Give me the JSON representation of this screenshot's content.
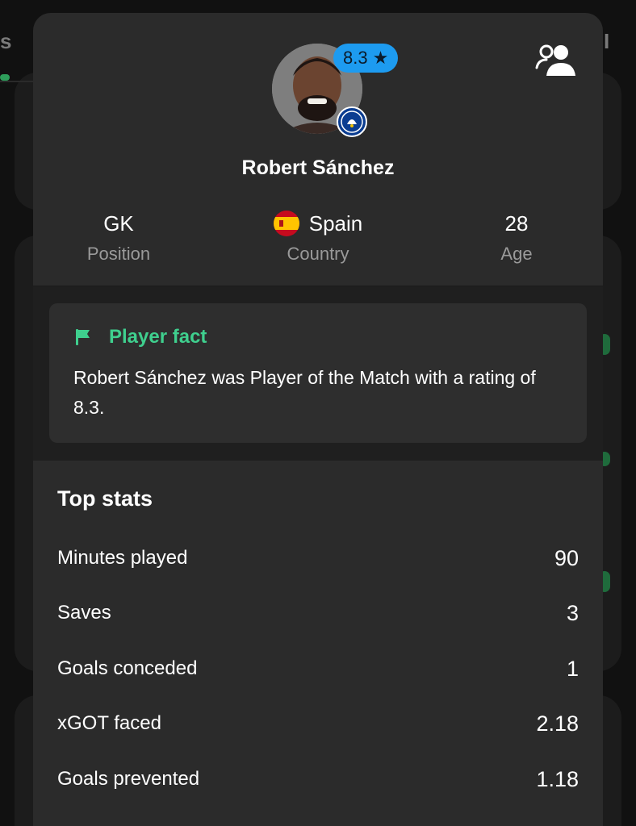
{
  "player": {
    "name": "Robert Sánchez",
    "rating": "8.3",
    "club_badge_icon": "club-crest-icon"
  },
  "info": {
    "position_value": "GK",
    "position_label": "Position",
    "country_value": "Spain",
    "country_label": "Country",
    "age_value": "28",
    "age_label": "Age"
  },
  "fact": {
    "title": "Player fact",
    "text": "Robert Sánchez was Player of the Match with a rating of 8.3."
  },
  "stats": {
    "title": "Top stats",
    "rows": [
      {
        "label": "Minutes played",
        "value": "90"
      },
      {
        "label": "Saves",
        "value": "3"
      },
      {
        "label": "Goals conceded",
        "value": "1"
      },
      {
        "label": "xGOT faced",
        "value": "2.18"
      },
      {
        "label": "Goals prevented",
        "value": "1.18"
      }
    ]
  },
  "background": {
    "left_text": "s",
    "right_text": "I"
  },
  "colors": {
    "accent_green": "#3fcf8e",
    "rating_blue": "#1d9bf0",
    "sheet_bg": "#2b2b2b"
  }
}
